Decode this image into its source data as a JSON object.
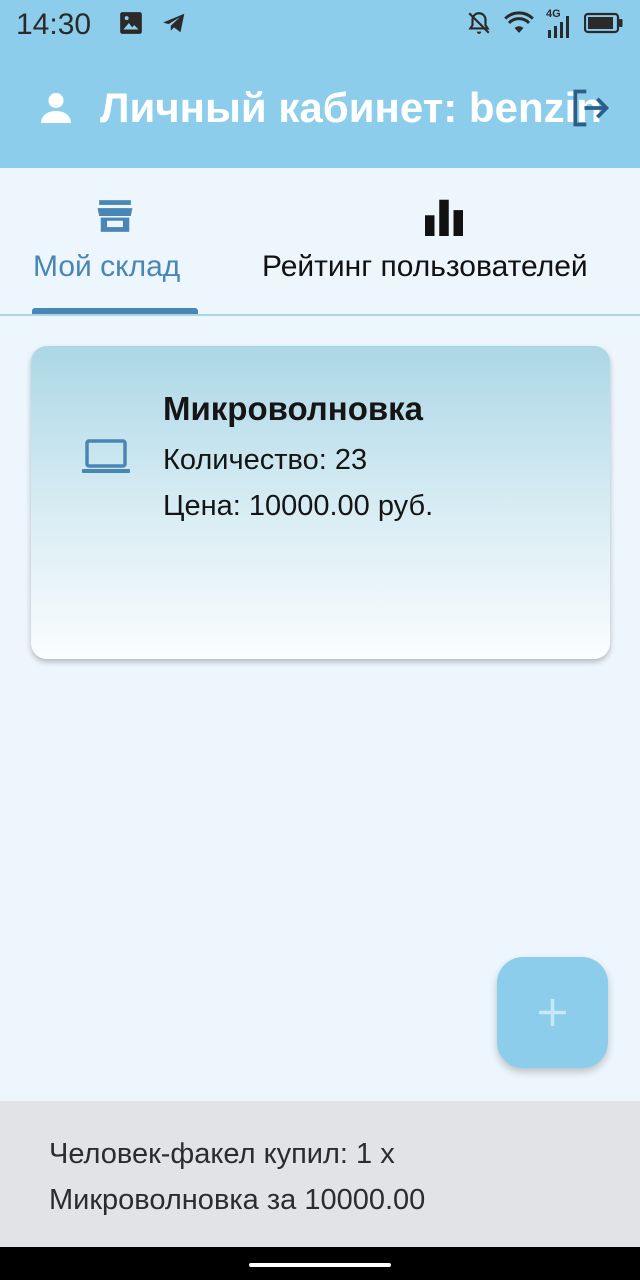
{
  "status_bar": {
    "time": "14:30",
    "left_icons": [
      "image-icon",
      "telegram-icon"
    ],
    "right_icons": [
      "bell-off-icon",
      "wifi-icon",
      "signal-4g-icon",
      "battery-icon"
    ],
    "network_label": "4G"
  },
  "header": {
    "title": "Личный кабинет: benzin",
    "user_icon": "person-icon",
    "logout_icon": "logout-icon"
  },
  "tabs": [
    {
      "label": "Мой склад",
      "icon": "store-icon",
      "active": true
    },
    {
      "label": "Рейтинг пользователей",
      "icon": "bar-chart-icon",
      "active": false
    }
  ],
  "products": [
    {
      "icon": "laptop-icon",
      "name": "Микроволновка",
      "quantity_text": "Количество: 23",
      "price_text": "Цена: 10000.00 руб."
    }
  ],
  "fab": {
    "icon": "plus-icon"
  },
  "notification": {
    "text": "Человек-факел купил: 1 х Микроволновка за 10000.00"
  },
  "colors": {
    "header_bg": "#8dcdec",
    "accent": "#4a86b5",
    "page_bg": "#eef6fd",
    "notification_bg": "#e2e3e7"
  }
}
